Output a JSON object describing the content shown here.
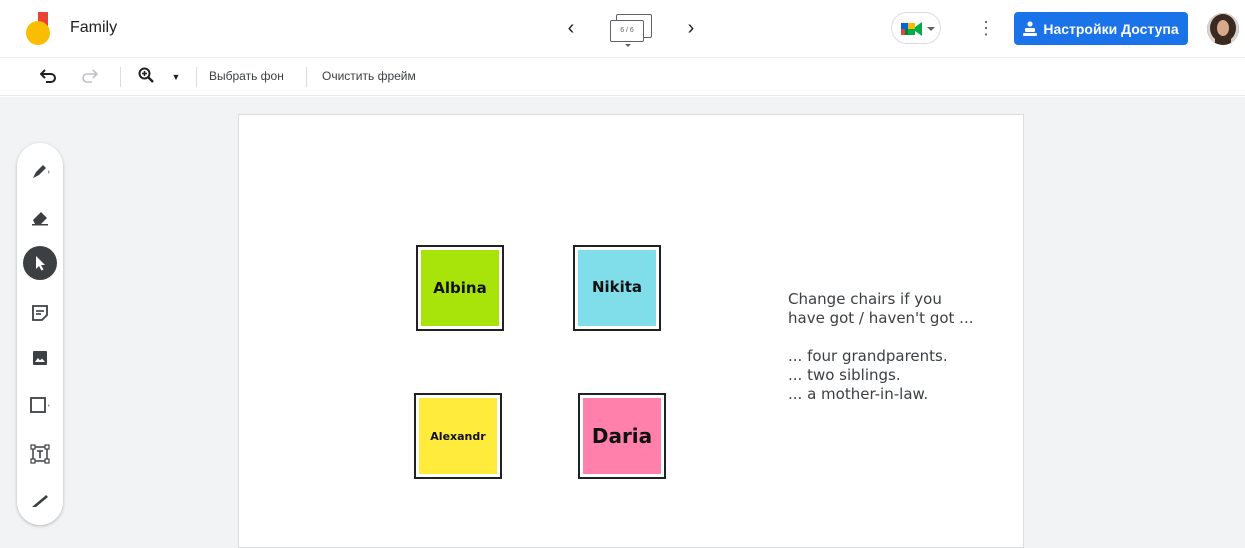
{
  "header": {
    "title": "Family",
    "frame_counter": "6 / 6",
    "share_label": "Настройки Доступа"
  },
  "toolbar": {
    "choose_background": "Выбрать фон",
    "clear_frame": "Очистить фрейм"
  },
  "tools": [
    "pen-icon",
    "eraser-icon",
    "select-icon",
    "sticky-note-icon",
    "image-icon",
    "shape-icon",
    "text-box-icon",
    "laser-icon"
  ],
  "notes": [
    {
      "name": "Albina",
      "color": "#a8e40a"
    },
    {
      "name": "Nikita",
      "color": "#80deea"
    },
    {
      "name": "Alexandr",
      "color": "#ffeb3b"
    },
    {
      "name": "Daria",
      "color": "#ff80ab"
    }
  ],
  "prompt": {
    "line1": "Change chairs if you",
    "line2": "have got / haven't got ...",
    "item1": "... four grandparents.",
    "item2": "... two siblings.",
    "item3": "... a mother-in-law."
  },
  "colors": {
    "accent": "#1a73e8"
  }
}
